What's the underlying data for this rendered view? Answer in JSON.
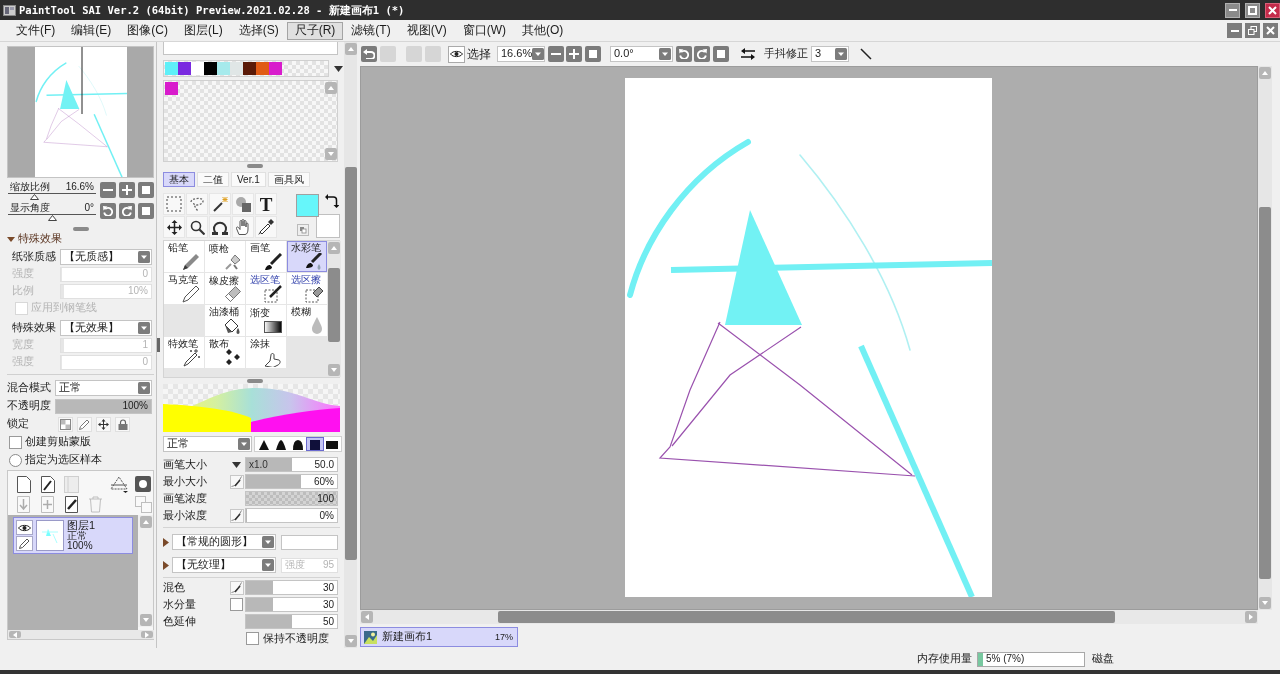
{
  "window": {
    "title": "PaintTool SAI Ver.2 (64bit) Preview.2021.02.28 - 新建画布1 (*)"
  },
  "menu": [
    {
      "label": "文件(F)",
      "selected": false
    },
    {
      "label": "编辑(E)",
      "selected": false
    },
    {
      "label": "图像(C)",
      "selected": false
    },
    {
      "label": "图层(L)",
      "selected": false
    },
    {
      "label": "选择(S)",
      "selected": false
    },
    {
      "label": "尺子(R)",
      "selected": true
    },
    {
      "label": "滤镜(T)",
      "selected": false
    },
    {
      "label": "视图(V)",
      "selected": false
    },
    {
      "label": "窗口(W)",
      "selected": false
    },
    {
      "label": "其他(O)",
      "selected": false
    }
  ],
  "navigator": {
    "zoom": {
      "label": "缩放比例",
      "value": "16.6%",
      "level": 0.3
    },
    "angle": {
      "label": "显示角度",
      "value": "0°",
      "level": 0.5
    }
  },
  "effects": {
    "title": "特殊效果",
    "expanded": true,
    "rows": [
      {
        "kind": "dropdown",
        "label": "纸张质感",
        "value": "【无质感】",
        "disabled": false
      },
      {
        "kind": "slider",
        "label": "强度",
        "value": "0",
        "level": 0,
        "disabled": true
      },
      {
        "kind": "slider",
        "label": "比例",
        "value": "10%",
        "level": 0.03,
        "disabled": true
      },
      {
        "kind": "checkbox",
        "label": "应用到钢笔线",
        "checked": false,
        "disabled": true
      },
      {
        "kind": "dropdown",
        "label": "特殊效果",
        "value": "【无效果】",
        "disabled": false
      },
      {
        "kind": "slider",
        "label": "宽度",
        "value": "1",
        "level": 0.03,
        "disabled": true
      },
      {
        "kind": "slider",
        "label": "强度",
        "value": "0",
        "level": 0,
        "disabled": true
      }
    ]
  },
  "layer_properties": {
    "blend": {
      "label": "混合模式",
      "value": "正常"
    },
    "opacity": {
      "label": "不透明度",
      "value": "100%",
      "level": 1
    },
    "lock_label": "锁定",
    "clip": {
      "label": "创建剪贴蒙版",
      "checked": false
    },
    "sample": {
      "label": "指定为选区样本",
      "selected": false
    }
  },
  "layer_tools": [
    {
      "kind": "new",
      "disabled": false
    },
    {
      "kind": "newpen",
      "disabled": false
    },
    {
      "kind": "folder",
      "disabled": true
    },
    {
      "kind": "ruler",
      "disabled": false
    },
    {
      "kind": "mask",
      "disabled": false
    },
    {
      "kind": "transfer",
      "disabled": true
    },
    {
      "kind": "merge",
      "disabled": true
    },
    {
      "kind": "clear",
      "disabled": false
    },
    {
      "kind": "delete",
      "disabled": true
    },
    {
      "kind": "copy",
      "disabled": true
    }
  ],
  "layers": [
    {
      "name": "图层1",
      "mode": "正常",
      "opacity": "100%",
      "visible": true,
      "selected": true
    }
  ],
  "palette": {
    "swatches": [
      {
        "color": "#5ff0f8"
      },
      {
        "color": "#7a2ae0"
      },
      {
        "color": "#ffffff"
      },
      {
        "color": "#000000"
      },
      {
        "color": "#a6eaec"
      },
      {
        "color": "#e0e6e6"
      },
      {
        "color": "#5a1a08"
      },
      {
        "color": "#e05a14"
      },
      {
        "color": "#d81ccc"
      }
    ],
    "custom_swatches": [
      {
        "color": "#d81ccc"
      }
    ]
  },
  "tool_tabs": [
    {
      "label": "基本",
      "selected": true
    },
    {
      "label": "二值",
      "selected": false
    },
    {
      "label": "Ver.1",
      "selected": false
    },
    {
      "label": "画具风",
      "selected": false
    }
  ],
  "tools": [
    {
      "kind": "rectselect"
    },
    {
      "kind": "lasso"
    },
    {
      "kind": "wand"
    },
    {
      "kind": "shapes"
    },
    {
      "kind": "text",
      "glyph": "T"
    },
    {
      "kind": "move"
    },
    {
      "kind": "zoom"
    },
    {
      "kind": "rotate"
    },
    {
      "kind": "hand"
    },
    {
      "kind": "eyedropper"
    }
  ],
  "colors": [
    {
      "kind": "foreground",
      "color": "#66f6fa"
    },
    {
      "kind": "background",
      "color": "#ffffff"
    }
  ],
  "brushes": [
    {
      "label": "铅笔",
      "kind": "pencil",
      "selected": false
    },
    {
      "label": "喷枪",
      "kind": "airbrush",
      "selected": false
    },
    {
      "label": "画笔",
      "kind": "brush",
      "selected": false
    },
    {
      "label": "水彩笔",
      "kind": "watercolor",
      "selected": true
    },
    {
      "label": "马克笔",
      "kind": "marker",
      "selected": false
    },
    {
      "label": "橡皮擦",
      "kind": "eraser",
      "selected": false
    },
    {
      "label": "选区笔",
      "kind": "selectpen",
      "selected": false
    },
    {
      "label": "选区擦",
      "kind": "selecteraser",
      "selected": false
    },
    {
      "kind": "empty"
    },
    {
      "label": "油漆桶",
      "kind": "bucket",
      "selected": false
    },
    {
      "label": "渐变",
      "kind": "gradient",
      "selected": false
    },
    {
      "label": "模糊",
      "kind": "blur",
      "selected": false
    },
    {
      "label": "特效笔",
      "kind": "fxpen",
      "selected": false
    },
    {
      "label": "散布",
      "kind": "scatter",
      "selected": false
    },
    {
      "label": "涂抹",
      "kind": "smudge",
      "selected": false
    },
    {
      "kind": "empty"
    }
  ],
  "brush_settings": {
    "mode": "正常",
    "tips": [
      {
        "selected": false
      },
      {
        "selected": false
      },
      {
        "selected": false
      },
      {
        "selected": true
      },
      {
        "selected": false
      }
    ],
    "rows": [
      {
        "kind": "size",
        "label": "画笔大小",
        "multiplier": "x1.0",
        "value": "50.0",
        "level": 0.5
      },
      {
        "kind": "pressure",
        "label": "最小大小",
        "value": "60%",
        "level": 0.6
      },
      {
        "kind": "texture",
        "label": "画笔浓度",
        "value": "100",
        "level": 1
      },
      {
        "kind": "pressure",
        "label": "最小浓度",
        "value": "0%",
        "level": 0
      }
    ],
    "shape": {
      "value": "【常规的圆形】",
      "expanded": false
    },
    "texture": {
      "value": "【无纹理】",
      "expanded": false,
      "strength_label": "强度",
      "strength_value": "95",
      "disabled": true
    },
    "mix_rows": [
      {
        "kind": "pressure",
        "label": "混色",
        "value": "30",
        "level": 0.3
      },
      {
        "kind": "checkbox",
        "label": "水分量",
        "checked": false,
        "value": "30",
        "level": 0.3
      },
      {
        "kind": "plain",
        "label": "色延伸",
        "value": "50",
        "level": 0.5
      }
    ],
    "keep_opacity": {
      "label": "保持不透明度",
      "checked": false
    }
  },
  "toolbar": {
    "buttons": [
      {
        "kind": "undo",
        "disabled": false
      },
      {
        "kind": "redo",
        "disabled": true
      },
      {
        "kind": "deselect",
        "disabled": true
      },
      {
        "kind": "invert",
        "disabled": true
      }
    ],
    "selection_label": "选择",
    "zoom": "16.6%",
    "angle": "0.0°",
    "stabilizer_label": "手抖修正",
    "stabilizer": "3"
  },
  "documents": [
    {
      "name": "新建画布1",
      "zoom": "17%",
      "selected": true
    }
  ],
  "status": {
    "memory": {
      "label": "内存使用量",
      "value": "5% (7%)",
      "level": 0.05
    },
    "disk_label": "磁盘"
  }
}
